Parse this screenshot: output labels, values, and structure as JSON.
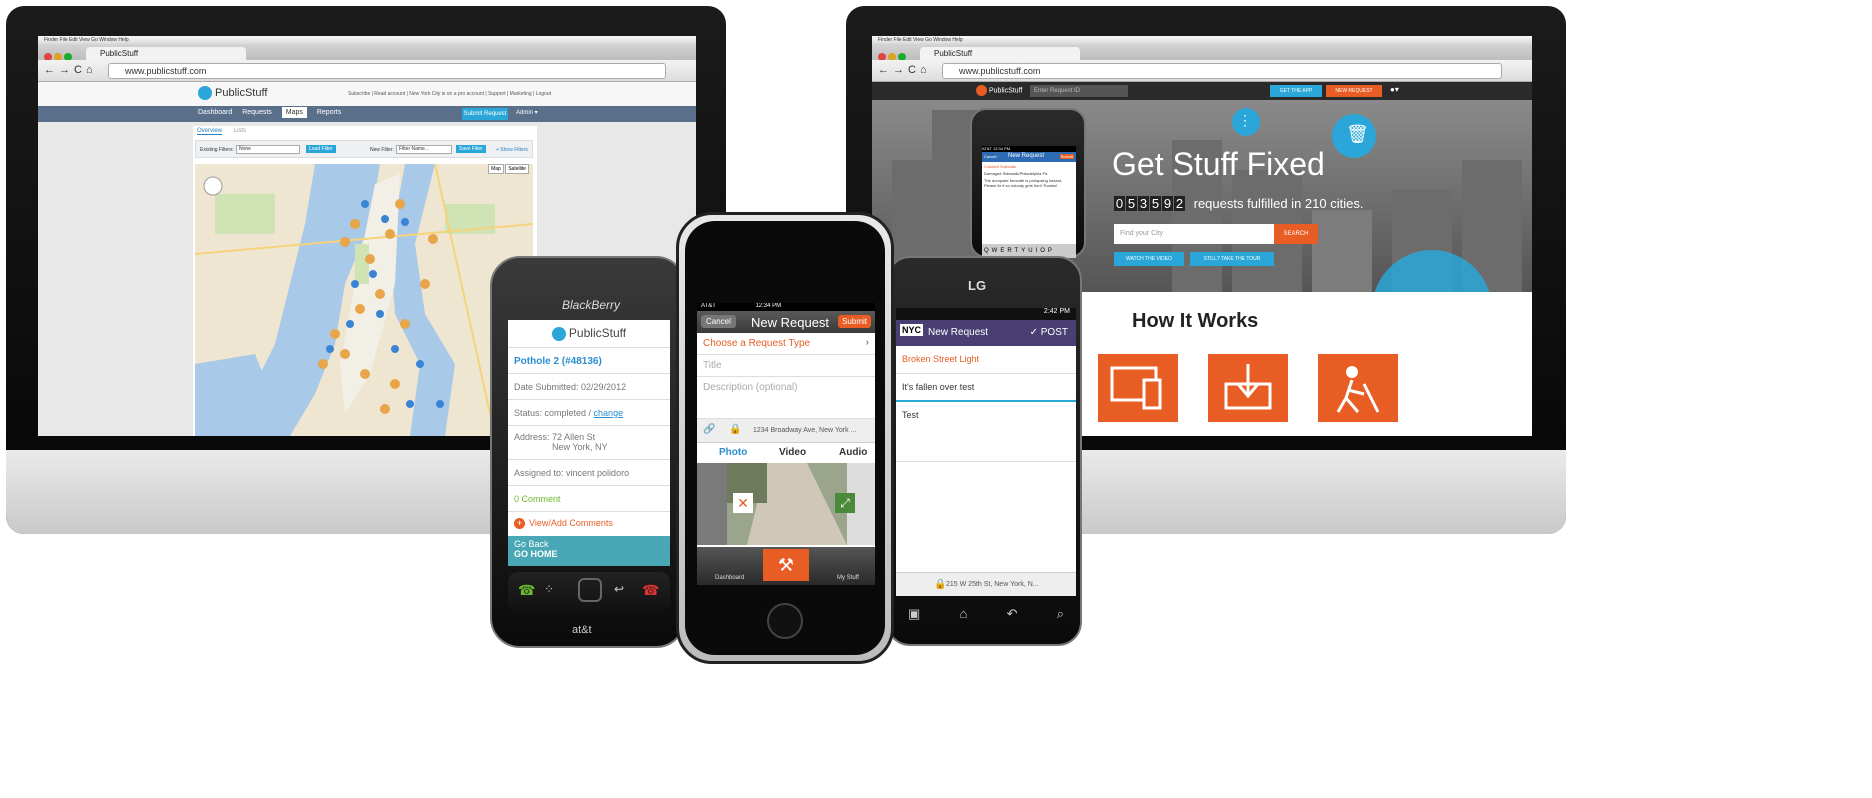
{
  "left_imac": {
    "browser": {
      "tab_title": "PublicStuff",
      "url": "www.publicstuff.com",
      "menu": "Finder  File  Edit  View  Go  Window  Help"
    },
    "site": {
      "logo": "PublicStuff",
      "top_links": "Subscribe | Read account | New York City is on a pro account | Support | Marketing | Logout",
      "nav_tabs": [
        "Dashboard",
        "Requests",
        "Maps",
        "Reports"
      ],
      "submit_button": "Submit Request",
      "admin_menu": "Admin ▾",
      "sub_tabs": [
        "Overview",
        "Lists"
      ],
      "filter_label": "Existing Filters:",
      "filter_value": "None",
      "filter_button": "Load Filter",
      "new_filter_label": "New Filter:",
      "new_filter_placeholder": "Filter Name...",
      "save_button": "Save Filter",
      "filter_note": "+ Show Filters",
      "map_buttons": [
        "Map",
        "Satellite"
      ]
    }
  },
  "right_imac": {
    "browser": {
      "tab_title": "PublicStuff",
      "url": "www.publicstuff.com",
      "menu": "Finder  File  Edit  View  Go  Window  Help"
    },
    "site": {
      "logo": "PublicStuff",
      "request_id_placeholder": "Enter Request ID",
      "get_app_button": "GET THE APP",
      "new_request_button": "NEW REQUEST",
      "hero_title": "Get Stuff Fixed",
      "counter_digits": [
        "0",
        "5",
        "3",
        "5",
        "9",
        "2"
      ],
      "counter_text": "requests fulfilled in 210 cities.",
      "city_placeholder": "Find your City",
      "search_button": "SEARCH",
      "watch_video_button": "WATCH THE VIDEO",
      "tour_button": "STILL? TAKE THE TOUR",
      "section_title": "How It Works"
    }
  },
  "blackberry": {
    "brand": "BlackBerry",
    "carrier": "at&t",
    "logo": "PublicStuff",
    "title": "Pothole 2 (#48136)",
    "date_submitted": "Date Submitted: 02/29/2012",
    "status_prefix": "Status: completed / ",
    "status_link": "change",
    "address_label": "Address:",
    "address_line1": "72 Allen St",
    "address_line2": "New York, NY",
    "assigned": "Assigned to: vincent polidoro",
    "comments": "0 Comment",
    "view_comments": "View/Add Comments",
    "go_back": "Go Back",
    "go_home": "GO HOME"
  },
  "iphone": {
    "status_left": "AT&T",
    "status_time": "12:34 PM",
    "cancel_button": "Cancel",
    "title": "New Request",
    "submit_button": "Submit",
    "request_type": "Choose a Request Type",
    "title_placeholder": "Title",
    "description_placeholder": "Description (optional)",
    "location": "1234 Broadway Ave, New York ...",
    "media_tabs": [
      "Photo",
      "Video",
      "Audio"
    ],
    "bottom_tabs": [
      "Dashboard",
      "",
      "My Stuff"
    ]
  },
  "small_iphone": {
    "carrier": "AT&T",
    "time": "12:34 PM",
    "cancel": "Cancel",
    "title": "New Request",
    "submit": "Submit",
    "line1": "Cracked Sidewalk",
    "line2": "Damaged Sidewalk/Philadelphia Pa",
    "body": "The dumpster beneath is prolapsing hazard. Please fix it so nobody gets hurt! Thanks!",
    "keys": "QWERTYUIOP"
  },
  "lg": {
    "brand": "LG",
    "time": "2:42 PM",
    "badge": "NYC",
    "title": "New Request",
    "post_button": "POST",
    "category": "Broken Street Light",
    "title_value": "It's fallen over test",
    "description_value": "Test",
    "location": "215 W 25th St, New York, N..."
  },
  "colors": {
    "orange": "#e85d24",
    "blue": "#2aa7d8",
    "teal": "#4aa7b5",
    "purple": "#4a3f72"
  }
}
